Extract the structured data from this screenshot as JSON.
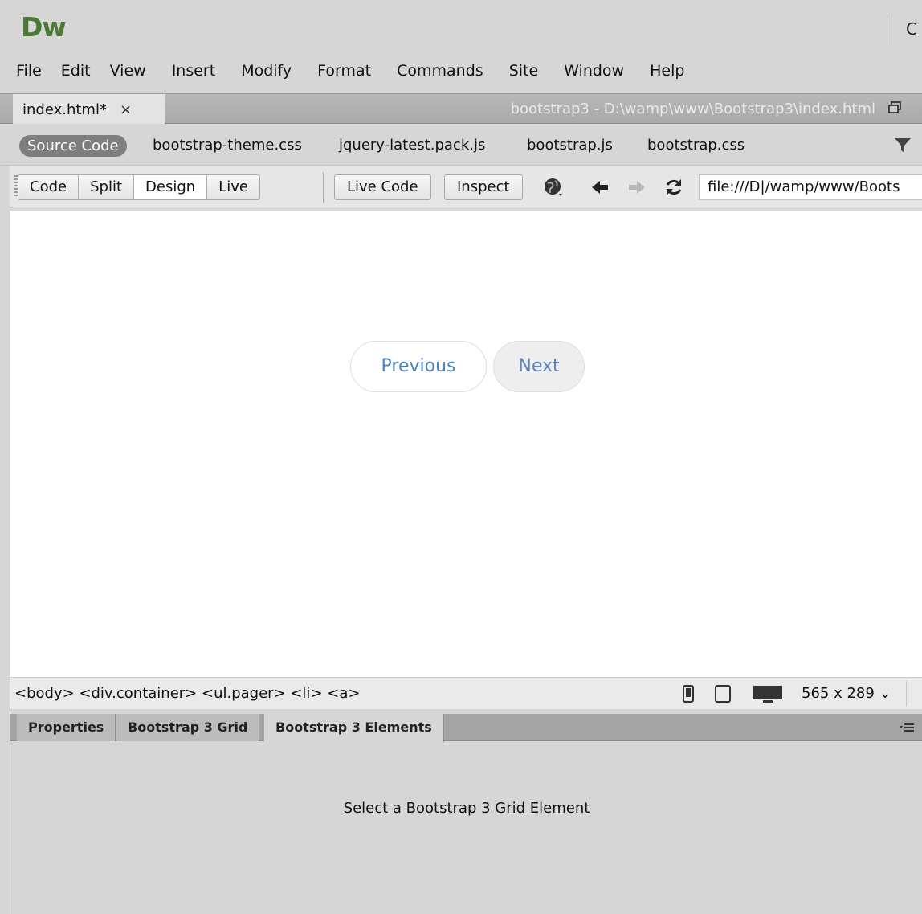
{
  "app": {
    "logo": "Dw",
    "title_cut": "C"
  },
  "menu": [
    "File",
    "Edit",
    "View",
    "Insert",
    "Modify",
    "Format",
    "Commands",
    "Site",
    "Window",
    "Help"
  ],
  "document_tab": {
    "label": "index.html*",
    "close": "×",
    "path": "bootstrap3 - D:\\wamp\\www\\Bootstrap3\\index.html"
  },
  "related_files": {
    "source_code": "Source Code",
    "files": [
      "bootstrap-theme.css",
      "jquery-latest.pack.js",
      "bootstrap.js",
      "bootstrap.css"
    ]
  },
  "toolbar": {
    "views": [
      "Code",
      "Split",
      "Design",
      "Live"
    ],
    "active_view": "Design",
    "live_code": "Live Code",
    "inspect": "Inspect",
    "url": "file:///D|/wamp/www/Boots"
  },
  "design_view": {
    "previous": "Previous",
    "next": "Next"
  },
  "status_bar": {
    "tag_path": "<body> <div.container> <ul.pager> <li> <a>",
    "dimensions": "565 x 289 ⌄"
  },
  "panel": {
    "tabs": [
      "Properties",
      "Bootstrap 3 Grid",
      "Bootstrap 3 Elements"
    ],
    "active_tab": "Bootstrap 3 Elements",
    "message": "Select a Bootstrap 3 Grid Element"
  },
  "colors": {
    "brand": "#4b7a35",
    "link": "#4a82c0",
    "panel_bg": "#d6d6d6"
  }
}
